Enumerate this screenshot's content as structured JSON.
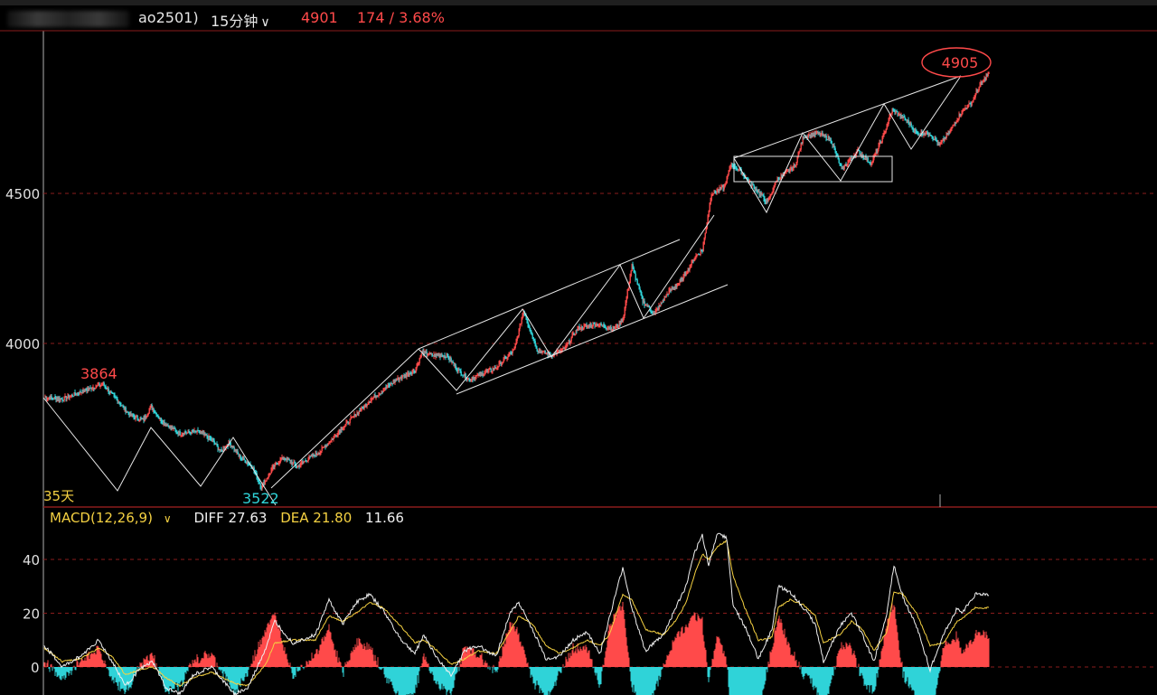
{
  "header": {
    "contract_code": "ao2501)",
    "period": "15分钟",
    "last_price": "4901",
    "change": "174 / 3.68%"
  },
  "colors": {
    "up": "#ff4a4a",
    "down": "#2fd3d8",
    "grid": "#8a1c1c",
    "trendline": "#e6e6e6",
    "diff_line": "#f0f0f0",
    "dea_line": "#f5d142",
    "yellow_text": "#f5d142"
  },
  "macd": {
    "name": "MACD(12,26,9)",
    "diff": "DIFF 27.63",
    "dea": "DEA 21.80",
    "hist": "11.66"
  },
  "chart_data": [
    {
      "type": "candlestick",
      "title": "",
      "y_ticks": [
        "4500",
        "4000"
      ],
      "ylim": [
        3450,
        4960
      ],
      "annotations": [
        {
          "label": "3864",
          "value": 3864,
          "color": "up"
        },
        {
          "label": "3522",
          "value": 3522,
          "color": "down"
        },
        {
          "label": "4905",
          "value": 4905,
          "color": "up",
          "circled": true
        }
      ],
      "corner_label": "35天",
      "price_path": [
        [
          0,
          3820
        ],
        [
          20,
          3815
        ],
        [
          40,
          3838
        ],
        [
          55,
          3855
        ],
        [
          65,
          3864
        ],
        [
          80,
          3812
        ],
        [
          95,
          3760
        ],
        [
          110,
          3745
        ],
        [
          118,
          3790
        ],
        [
          130,
          3740
        ],
        [
          150,
          3700
        ],
        [
          170,
          3705
        ],
        [
          185,
          3680
        ],
        [
          195,
          3640
        ],
        [
          205,
          3670
        ],
        [
          215,
          3625
        ],
        [
          230,
          3590
        ],
        [
          240,
          3522
        ],
        [
          255,
          3595
        ],
        [
          265,
          3620
        ],
        [
          280,
          3590
        ],
        [
          290,
          3612
        ],
        [
          305,
          3640
        ],
        [
          330,
          3720
        ],
        [
          360,
          3810
        ],
        [
          390,
          3880
        ],
        [
          410,
          3910
        ],
        [
          418,
          3970
        ],
        [
          430,
          3960
        ],
        [
          445,
          3960
        ],
        [
          458,
          3910
        ],
        [
          470,
          3880
        ],
        [
          500,
          3920
        ],
        [
          520,
          3980
        ],
        [
          530,
          4110
        ],
        [
          545,
          3980
        ],
        [
          560,
          3960
        ],
        [
          575,
          3980
        ],
        [
          590,
          4050
        ],
        [
          610,
          4065
        ],
        [
          630,
          4050
        ],
        [
          640,
          4080
        ],
        [
          650,
          4260
        ],
        [
          662,
          4140
        ],
        [
          675,
          4100
        ],
        [
          690,
          4170
        ],
        [
          705,
          4210
        ],
        [
          720,
          4290
        ],
        [
          728,
          4310
        ],
        [
          738,
          4500
        ],
        [
          752,
          4520
        ],
        [
          760,
          4600
        ],
        [
          770,
          4575
        ],
        [
          785,
          4520
        ],
        [
          800,
          4470
        ],
        [
          810,
          4545
        ],
        [
          830,
          4590
        ],
        [
          840,
          4690
        ],
        [
          855,
          4700
        ],
        [
          870,
          4680
        ],
        [
          882,
          4580
        ],
        [
          900,
          4640
        ],
        [
          915,
          4600
        ],
        [
          928,
          4690
        ],
        [
          938,
          4780
        ],
        [
          955,
          4740
        ],
        [
          965,
          4700
        ],
        [
          980,
          4700
        ],
        [
          990,
          4660
        ],
        [
          1000,
          4700
        ],
        [
          1015,
          4775
        ],
        [
          1025,
          4800
        ],
        [
          1035,
          4860
        ],
        [
          1045,
          4901
        ]
      ]
    },
    {
      "type": "macd",
      "y_ticks": [
        "40",
        "20",
        "0"
      ],
      "ylim": [
        -11,
        50
      ],
      "series": [
        {
          "name": "DIFF",
          "color": "diff_line"
        },
        {
          "name": "DEA",
          "color": "dea_line"
        }
      ],
      "diff_points": [
        [
          0,
          8
        ],
        [
          20,
          0
        ],
        [
          40,
          4
        ],
        [
          60,
          10
        ],
        [
          75,
          2
        ],
        [
          90,
          -7
        ],
        [
          105,
          -1
        ],
        [
          120,
          2
        ],
        [
          135,
          -8
        ],
        [
          150,
          -10
        ],
        [
          165,
          -3
        ],
        [
          185,
          0
        ],
        [
          210,
          -10
        ],
        [
          225,
          -8
        ],
        [
          245,
          7
        ],
        [
          255,
          17
        ],
        [
          275,
          9
        ],
        [
          300,
          12
        ],
        [
          315,
          25
        ],
        [
          330,
          16
        ],
        [
          345,
          24
        ],
        [
          360,
          27
        ],
        [
          375,
          21
        ],
        [
          395,
          10
        ],
        [
          410,
          5
        ],
        [
          420,
          12
        ],
        [
          435,
          3
        ],
        [
          450,
          -3
        ],
        [
          465,
          6
        ],
        [
          480,
          8
        ],
        [
          500,
          4
        ],
        [
          515,
          20
        ],
        [
          525,
          24
        ],
        [
          540,
          14
        ],
        [
          555,
          3
        ],
        [
          570,
          4
        ],
        [
          585,
          10
        ],
        [
          600,
          13
        ],
        [
          615,
          5
        ],
        [
          625,
          18
        ],
        [
          640,
          37
        ],
        [
          650,
          22
        ],
        [
          665,
          6
        ],
        [
          685,
          12
        ],
        [
          700,
          23
        ],
        [
          710,
          30
        ],
        [
          720,
          43
        ],
        [
          728,
          49
        ],
        [
          735,
          38
        ],
        [
          745,
          50
        ],
        [
          755,
          48
        ],
        [
          762,
          23
        ],
        [
          775,
          15
        ],
        [
          790,
          3
        ],
        [
          805,
          14
        ],
        [
          812,
          30
        ],
        [
          825,
          28
        ],
        [
          840,
          22
        ],
        [
          853,
          16
        ],
        [
          862,
          2
        ],
        [
          880,
          15
        ],
        [
          893,
          20
        ],
        [
          905,
          12
        ],
        [
          918,
          2
        ],
        [
          932,
          20
        ],
        [
          940,
          38
        ],
        [
          950,
          26
        ],
        [
          965,
          15
        ],
        [
          980,
          -1
        ],
        [
          995,
          12
        ],
        [
          1010,
          22
        ],
        [
          1015,
          20
        ],
        [
          1030,
          27
        ]
      ],
      "dea_points": [
        [
          0,
          7
        ],
        [
          20,
          2
        ],
        [
          40,
          3
        ],
        [
          60,
          7
        ],
        [
          75,
          4
        ],
        [
          90,
          -3
        ],
        [
          105,
          -1
        ],
        [
          120,
          0
        ],
        [
          135,
          -4
        ],
        [
          150,
          -7
        ],
        [
          165,
          -4
        ],
        [
          185,
          -2
        ],
        [
          210,
          -6
        ],
        [
          225,
          -7
        ],
        [
          245,
          1
        ],
        [
          255,
          9
        ],
        [
          275,
          10
        ],
        [
          300,
          10
        ],
        [
          315,
          19
        ],
        [
          330,
          17
        ],
        [
          345,
          20
        ],
        [
          360,
          24
        ],
        [
          375,
          22
        ],
        [
          395,
          15
        ],
        [
          410,
          9
        ],
        [
          420,
          10
        ],
        [
          435,
          6
        ],
        [
          450,
          1
        ],
        [
          465,
          3
        ],
        [
          480,
          6
        ],
        [
          500,
          5
        ],
        [
          515,
          13
        ],
        [
          525,
          19
        ],
        [
          540,
          16
        ],
        [
          555,
          8
        ],
        [
          570,
          5
        ],
        [
          585,
          7
        ],
        [
          600,
          10
        ],
        [
          615,
          8
        ],
        [
          625,
          12
        ],
        [
          640,
          27
        ],
        [
          650,
          25
        ],
        [
          665,
          14
        ],
        [
          685,
          12
        ],
        [
          700,
          18
        ],
        [
          710,
          24
        ],
        [
          720,
          35
        ],
        [
          728,
          42
        ],
        [
          735,
          40
        ],
        [
          745,
          45
        ],
        [
          755,
          47
        ],
        [
          762,
          34
        ],
        [
          775,
          22
        ],
        [
          790,
          10
        ],
        [
          805,
          11
        ],
        [
          812,
          22
        ],
        [
          825,
          25
        ],
        [
          840,
          23
        ],
        [
          853,
          19
        ],
        [
          862,
          9
        ],
        [
          880,
          12
        ],
        [
          893,
          17
        ],
        [
          905,
          14
        ],
        [
          918,
          6
        ],
        [
          932,
          13
        ],
        [
          940,
          28
        ],
        [
          950,
          27
        ],
        [
          965,
          20
        ],
        [
          980,
          8
        ],
        [
          995,
          9
        ],
        [
          1010,
          17
        ],
        [
          1015,
          18
        ],
        [
          1030,
          22
        ]
      ]
    }
  ]
}
